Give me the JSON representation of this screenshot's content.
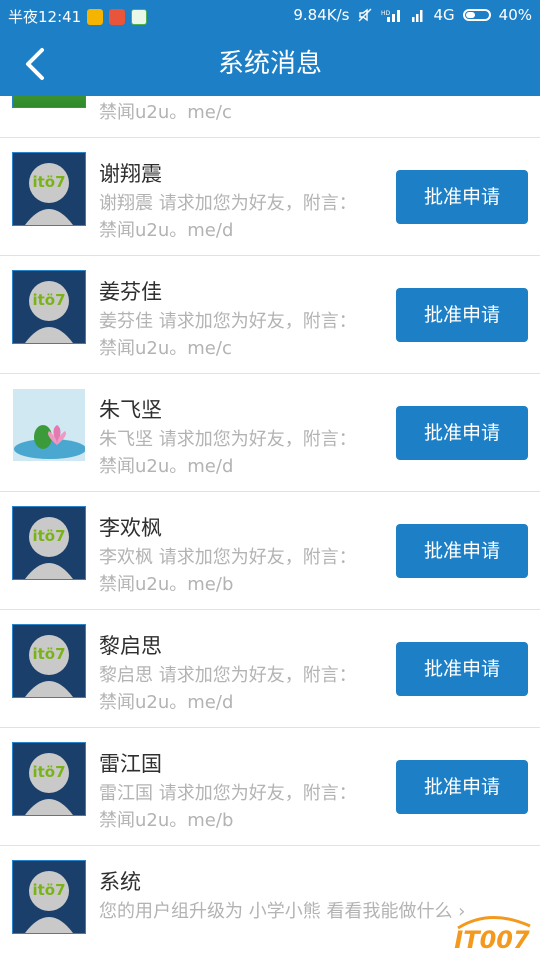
{
  "status": {
    "time": "半夜12:41",
    "speed": "9.84K/s",
    "network": "4G",
    "battery": "40%"
  },
  "header": {
    "title": "系统消息"
  },
  "top_partial": {
    "msg_line2": "禁闻u2u。me/c"
  },
  "rows": [
    {
      "name": "谢翔震",
      "msg": "谢翔震 请求加您为好友，附言：",
      "msg2": "禁闻u2u。me/d",
      "button": "批准申请",
      "avatar": "ito7-avatar"
    },
    {
      "name": "姜芬佳",
      "msg": "姜芬佳 请求加您为好友，附言：",
      "msg2": "禁闻u2u。me/c",
      "button": "批准申请",
      "avatar": "ito7-avatar"
    },
    {
      "name": "朱飞坚",
      "msg": "朱飞坚 请求加您为好友，附言：",
      "msg2": "禁闻u2u。me/d",
      "button": "批准申请",
      "avatar": "lotus-avatar"
    },
    {
      "name": "李欢枫",
      "msg": "李欢枫 请求加您为好友，附言：",
      "msg2": "禁闻u2u。me/b",
      "button": "批准申请",
      "avatar": "ito7-avatar"
    },
    {
      "name": "黎启思",
      "msg": "黎启思 请求加您为好友，附言：",
      "msg2": "禁闻u2u。me/d",
      "button": "批准申请",
      "avatar": "ito7-avatar"
    },
    {
      "name": "雷江国",
      "msg": "雷江国 请求加您为好友，附言：",
      "msg2": "禁闻u2u。me/b",
      "button": "批准申请",
      "avatar": "ito7-avatar"
    }
  ],
  "system_row": {
    "name": "系统",
    "msg": "您的用户组升级为 小学小熊 看看我能做什么 ›"
  },
  "watermark": "IT007",
  "colors": {
    "primary": "#1d7fc6"
  }
}
